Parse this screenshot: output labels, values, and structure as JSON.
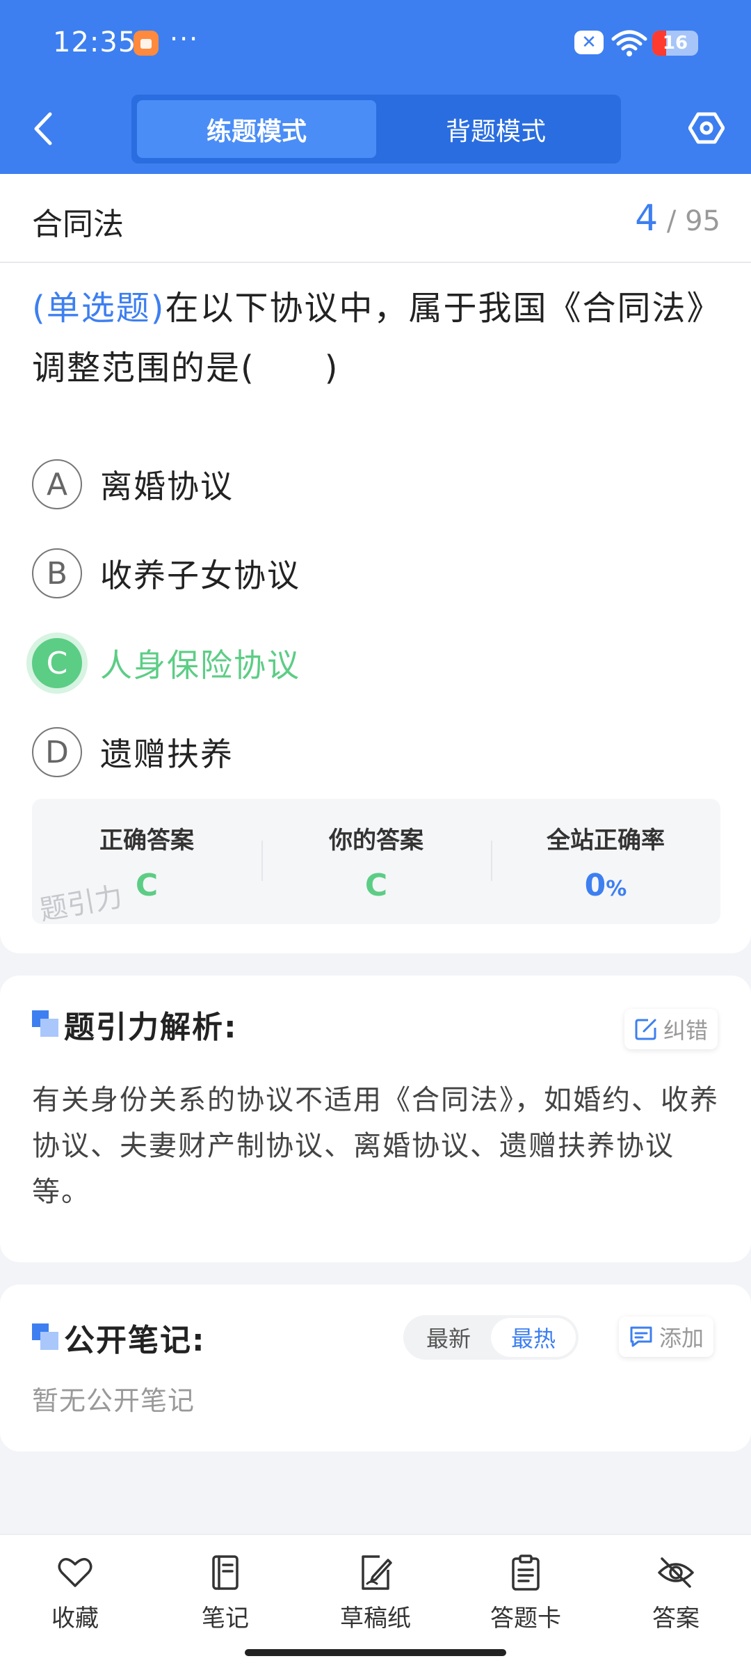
{
  "status_bar": {
    "time": "12:35",
    "battery": "16"
  },
  "header": {
    "tabs": [
      {
        "label": "练题模式",
        "active": true
      },
      {
        "label": "背题模式",
        "active": false
      }
    ]
  },
  "topic": {
    "title": "合同法",
    "current": "4",
    "total": "/ 95"
  },
  "question": {
    "type": "(单选题)",
    "text": "在以下协议中，属于我国《合同法》调整范围的是(　　)",
    "options": [
      {
        "letter": "A",
        "text": "离婚协议",
        "correct": false
      },
      {
        "letter": "B",
        "text": "收养子女协议",
        "correct": false
      },
      {
        "letter": "C",
        "text": "人身保险协议",
        "correct": true
      },
      {
        "letter": "D",
        "text": "遗赠扶养",
        "correct": false
      }
    ]
  },
  "answer_summary": {
    "correct_label": "正确答案",
    "correct_value": "C",
    "yours_label": "你的答案",
    "yours_value": "C",
    "rate_label": "全站正确率",
    "rate_value": "0",
    "rate_unit": "%",
    "watermark": "题引力"
  },
  "analysis": {
    "title": "题引力解析:",
    "report_label": "纠错",
    "text": "有关身份关系的协议不适用《合同法》，如婚约、收养协议、夫妻财产制协议、离婚协议、遗赠扶养协议等。"
  },
  "notes": {
    "title": "公开笔记:",
    "sort_options": [
      "最新",
      "最热"
    ],
    "sort_active": "最热",
    "add_label": "添加",
    "empty_text": "暂无公开笔记"
  },
  "bottom_bar": [
    {
      "label": "收藏",
      "icon": "heart-icon"
    },
    {
      "label": "笔记",
      "icon": "notebook-icon"
    },
    {
      "label": "草稿纸",
      "icon": "draft-icon"
    },
    {
      "label": "答题卡",
      "icon": "clipboard-icon"
    },
    {
      "label": "答案",
      "icon": "eye-off-icon"
    }
  ],
  "colors": {
    "primary": "#3d7ff0",
    "correct": "#5ccd85"
  }
}
